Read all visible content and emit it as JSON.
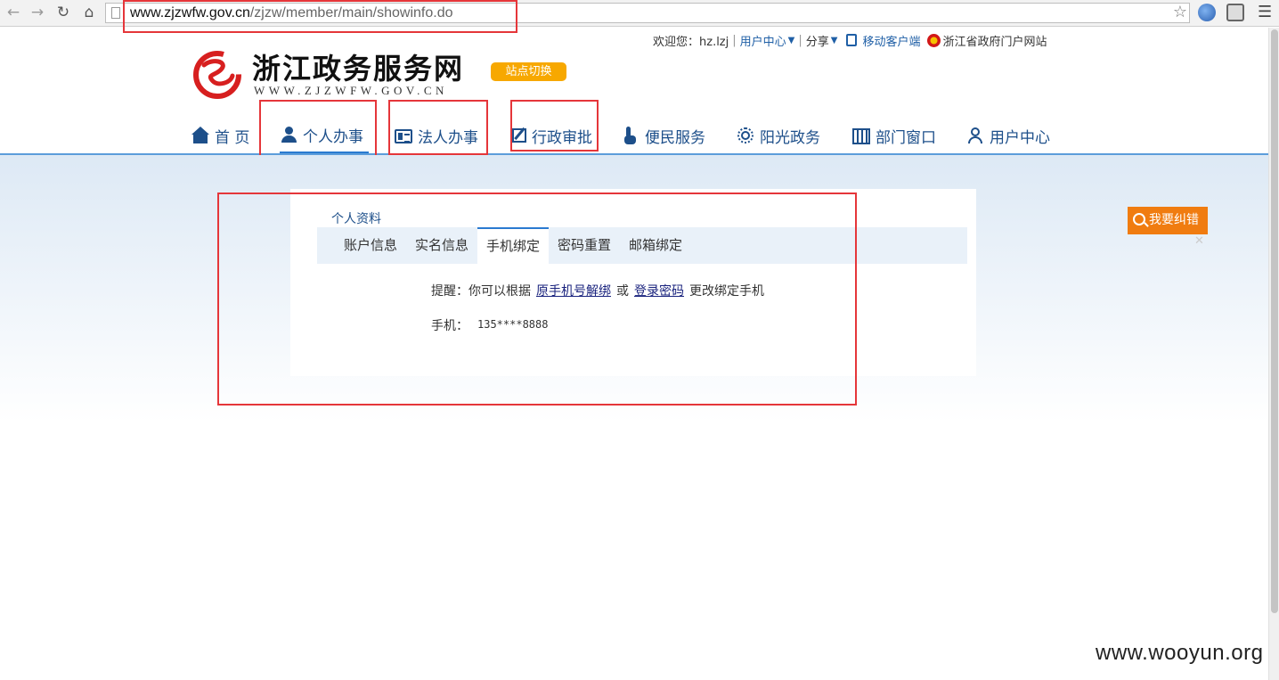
{
  "browser": {
    "url_host": "www.zjzwfw.gov.cn",
    "url_path": "/zjzw/member/main/showinfo.do",
    "back_icon": "back-arrow-icon",
    "forward_icon": "forward-arrow-icon",
    "reload_icon": "reload-icon",
    "home_icon": "home-icon",
    "bookmark_icon": "star-icon",
    "menu_icon": "hamburger-icon"
  },
  "topbar": {
    "welcome": "欢迎您：hz.lzj",
    "user_center": "用户中心",
    "share": "分享",
    "mobile_client": "移动客户端",
    "provincial_portal": "浙江省政府门户网站"
  },
  "header": {
    "site_title": "浙江政务服务网",
    "site_domain": "WWW.ZJZWFW.GOV.CN",
    "site_switch": "站点切换"
  },
  "nav": {
    "items": [
      {
        "label": "首 页",
        "icon": "home-icon"
      },
      {
        "label": "个人办事",
        "icon": "person-icon",
        "active": true
      },
      {
        "label": "法人办事",
        "icon": "id-card-icon"
      },
      {
        "label": "行政审批",
        "icon": "edit-icon"
      },
      {
        "label": "便民服务",
        "icon": "hand-pointer-icon"
      },
      {
        "label": "阳光政务",
        "icon": "sun-icon"
      },
      {
        "label": "部门窗口",
        "icon": "building-icon"
      },
      {
        "label": "用户中心",
        "icon": "user-icon"
      }
    ]
  },
  "profile": {
    "title": "个人资料",
    "tabs": [
      {
        "label": "账户信息"
      },
      {
        "label": "实名信息"
      },
      {
        "label": "手机绑定",
        "active": true
      },
      {
        "label": "密码重置"
      },
      {
        "label": "邮箱绑定"
      }
    ],
    "notice_prefix": "提醒：你可以根据",
    "notice_link1": "原手机号解绑",
    "notice_or": "或",
    "notice_link2": "登录密码",
    "notice_suffix": "更改绑定手机",
    "phone_label": "手机：",
    "phone_value": "135****8888"
  },
  "feedback": {
    "label": "我要纠错",
    "close": "✕"
  },
  "watermark": "www.wooyun.org",
  "colors": {
    "nav_text": "#1d4f8a",
    "accent_blue": "#2a7ad0",
    "switch_orange": "#f7a800",
    "feedback_orange": "#f07c10",
    "annotation_red": "#e5363a"
  }
}
